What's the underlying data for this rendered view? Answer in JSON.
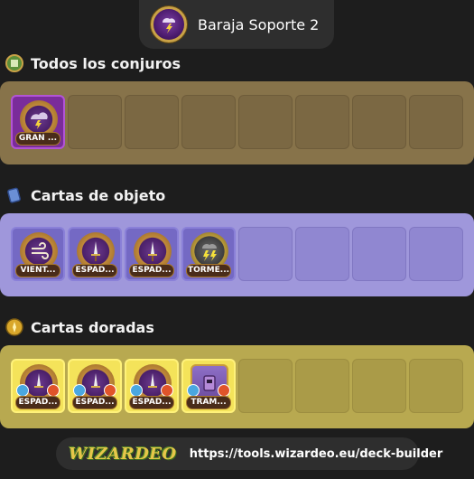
{
  "deck": {
    "title": "Baraja Soporte 2",
    "icon": "storm-school-icon"
  },
  "sections": {
    "spells": {
      "label": "Todos los conjuros",
      "icon": "spellbook-icon",
      "color": "#87734a",
      "cards": [
        {
          "name": "GRAN ...",
          "icon": "storm-cloud-icon"
        }
      ]
    },
    "items": {
      "label": "Cartas de objeto",
      "icon": "item-card-icon",
      "color": "#9f97db",
      "cards": [
        {
          "name": "VIENT...",
          "icon": "wind-icon"
        },
        {
          "name": "ESPAD...",
          "icon": "sword-icon"
        },
        {
          "name": "ESPAD...",
          "icon": "sword-icon"
        },
        {
          "name": "TORME...",
          "icon": "lightning-icon"
        }
      ]
    },
    "gold": {
      "label": "Cartas doradas",
      "icon": "gold-card-icon",
      "color": "#b8a950",
      "cards": [
        {
          "name": "ESPAD...",
          "icon": "sword-icon"
        },
        {
          "name": "ESPAD...",
          "icon": "sword-icon"
        },
        {
          "name": "ESPAD...",
          "icon": "sword-icon"
        },
        {
          "name": "TRAM...",
          "icon": "trap-icon"
        }
      ]
    }
  },
  "footer": {
    "logo": "WIZARDEO",
    "url": "https://tools.wizardeo.eu/deck-builder"
  }
}
